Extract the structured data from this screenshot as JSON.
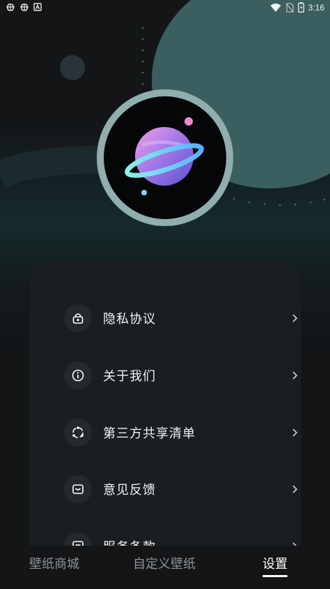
{
  "status_bar": {
    "left_icons": [
      "bug-icon",
      "bug-icon",
      "a-icon"
    ],
    "right_icons": [
      "wifi-icon",
      "no-sim-icon",
      "battery-icon"
    ],
    "time": "3:16"
  },
  "avatar": {
    "icon": "planet-icon"
  },
  "menu": {
    "items": [
      {
        "label": "隐私协议",
        "icon": "lock-icon"
      },
      {
        "label": "关于我们",
        "icon": "info-icon"
      },
      {
        "label": "第三方共享清单",
        "icon": "share-circle-icon"
      },
      {
        "label": "意见反馈",
        "icon": "feedback-icon"
      },
      {
        "label": "服务条款",
        "icon": "terms-icon"
      }
    ]
  },
  "bottom_nav": {
    "tabs": [
      {
        "label": "壁纸商城",
        "active": false
      },
      {
        "label": "自定义壁纸",
        "active": false
      },
      {
        "label": "设置",
        "active": true
      }
    ]
  },
  "colors": {
    "background": "#131517",
    "card": "#1b1e21",
    "accent_teal": "#3b5e5e",
    "ring": "#90aeae",
    "active_tab": "#ffffff",
    "inactive_tab": "#8f9295"
  }
}
